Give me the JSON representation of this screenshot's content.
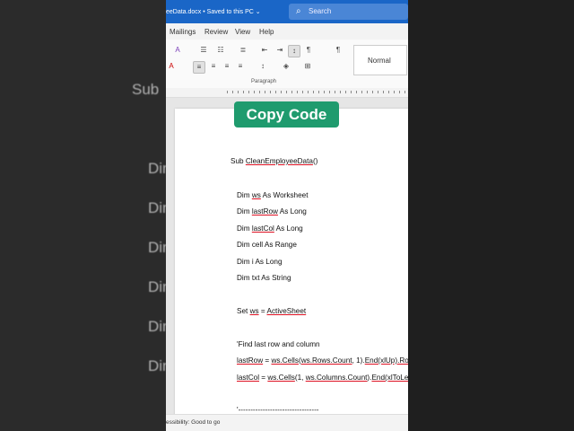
{
  "window": {
    "title": "eeData.docx",
    "saved_status": "Saved to this PC",
    "search_placeholder": "Search"
  },
  "menu": [
    "Mailings",
    "Review",
    "View",
    "Help"
  ],
  "ribbon": {
    "style_name": "Normal",
    "group_paragraph": "Paragraph"
  },
  "copy_button": {
    "label": "Copy Code"
  },
  "document": {
    "lines": {
      "l1_prefix": "Sub ",
      "l1_name": "CleanEmployeeData",
      "l1_suffix": "()",
      "l2_pre": "Dim ",
      "l2_var": "ws",
      "l2_post": " As Worksheet",
      "l3_pre": "Dim ",
      "l3_var": "lastRow",
      "l3_post": " As Long",
      "l4_pre": "Dim ",
      "l4_var": "lastCol",
      "l4_post": " As Long",
      "l5": "Dim cell As Range",
      "l6": "Dim i As Long",
      "l7": "Dim txt As String",
      "l8_pre": "Set ",
      "l8_var": "ws",
      "l8_mid": " = ",
      "l8_val": "ActiveSheet",
      "l9": "'Find last row and column",
      "l10_a": "lastRow",
      "l10_b": " = ",
      "l10_c": "ws.Cells",
      "l10_d": "(",
      "l10_e": "ws.Rows.Count",
      "l10_f": ", 1).",
      "l10_g": "End(xlUp).Row",
      "l11_a": "lastCol",
      "l11_b": " = ",
      "l11_c": "ws.Cells",
      "l11_d": "(1, ",
      "l11_e": "ws.Columns.Count",
      "l11_f": ").",
      "l11_g": "End(xlToLe",
      "l12": "'---------------------------------"
    }
  },
  "status": {
    "accessibility": "essibility: Good to go"
  },
  "background_ghost": {
    "sub": "Sub",
    "dim": "Dim"
  }
}
